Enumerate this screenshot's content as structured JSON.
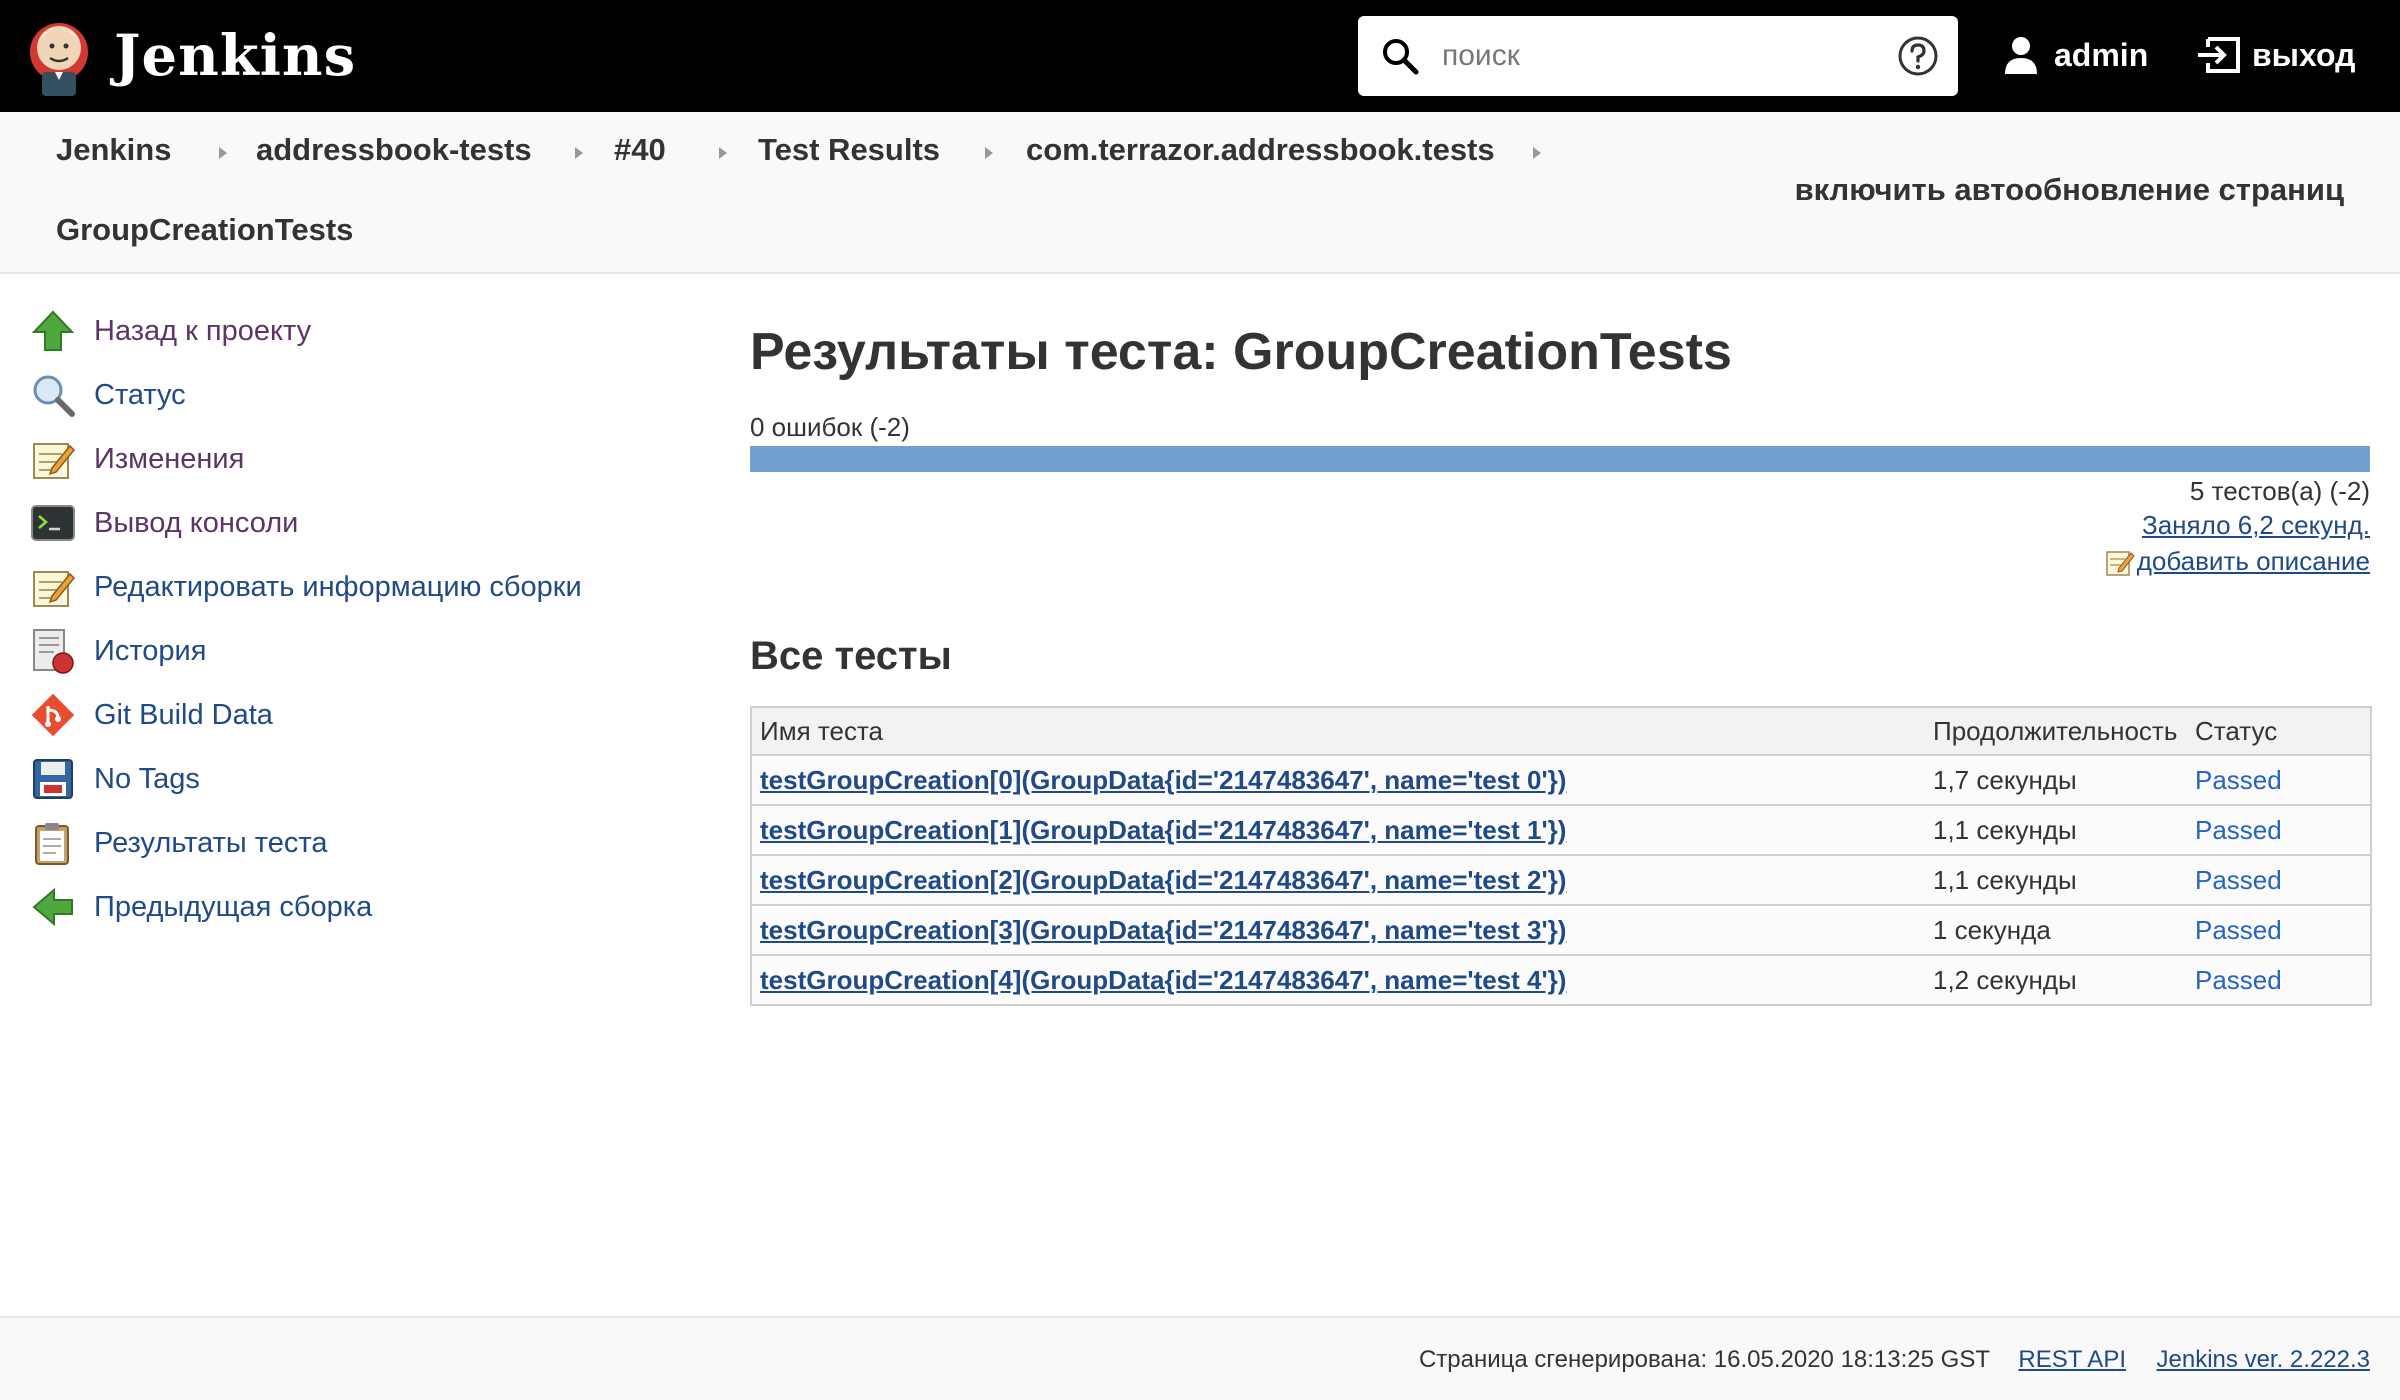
{
  "header": {
    "app_name": "Jenkins",
    "search_placeholder": "поиск",
    "user_label": "admin",
    "logout_label": "выход"
  },
  "breadcrumbs": {
    "items": [
      "Jenkins",
      "addressbook-tests",
      "#40",
      "Test Results",
      "com.terrazor.addressbook.tests",
      "GroupCreationTests"
    ],
    "autorefresh_label": "включить автообновление страниц"
  },
  "side_panel": {
    "tasks": [
      {
        "label": "Назад к проекту",
        "icon": "up-arrow-icon"
      },
      {
        "label": "Статус",
        "icon": "magnifier-icon"
      },
      {
        "label": "Изменения",
        "icon": "notepad-icon"
      },
      {
        "label": "Вывод консоли",
        "icon": "terminal-icon"
      },
      {
        "label": "Редактировать информацию сборки",
        "icon": "notepad-icon"
      },
      {
        "label": "История",
        "icon": "history-icon"
      },
      {
        "label": "Git Build Data",
        "icon": "git-icon"
      },
      {
        "label": "No Tags",
        "icon": "floppy-disk-icon"
      },
      {
        "label": "Результаты теста",
        "icon": "clipboard-icon"
      },
      {
        "label": "Предыдущая сборка",
        "icon": "left-arrow-icon"
      }
    ]
  },
  "main": {
    "title": "Результаты теста: GroupCreationTests",
    "fail_count": "0 ошибок (-2)",
    "pass_fraction": 1.0,
    "test_count": "5 тестов(а) (-2)",
    "duration_link": "Заняло 6,2 секунд.",
    "add_description": "добавить описание",
    "all_tests_heading": "Все тесты",
    "table": {
      "headers": [
        "Имя теста",
        "Продолжительность",
        "Статус"
      ],
      "rows": [
        {
          "name": "testGroupCreation[0](GroupData{id='2147483647', name='test 0'})",
          "duration": "1,7 секунды",
          "status": "Passed"
        },
        {
          "name": "testGroupCreation[1](GroupData{id='2147483647', name='test 1'})",
          "duration": "1,1 секунды",
          "status": "Passed"
        },
        {
          "name": "testGroupCreation[2](GroupData{id='2147483647', name='test 2'})",
          "duration": "1,1 секунды",
          "status": "Passed"
        },
        {
          "name": "testGroupCreation[3](GroupData{id='2147483647', name='test 3'})",
          "duration": "1 секунда",
          "status": "Passed"
        },
        {
          "name": "testGroupCreation[4](GroupData{id='2147483647', name='test 4'})",
          "duration": "1,2 секунды",
          "status": "Passed"
        }
      ]
    }
  },
  "footer": {
    "generated": "Страница сгенерирована: 16.05.2020 18:13:25 GST",
    "rest_api": "REST API",
    "version": "Jenkins ver. 2.222.3"
  },
  "colors": {
    "header_bg": "#000000",
    "progress_pass": "#729fcf",
    "link": "#204a87",
    "status_passed": "#2563c4"
  }
}
